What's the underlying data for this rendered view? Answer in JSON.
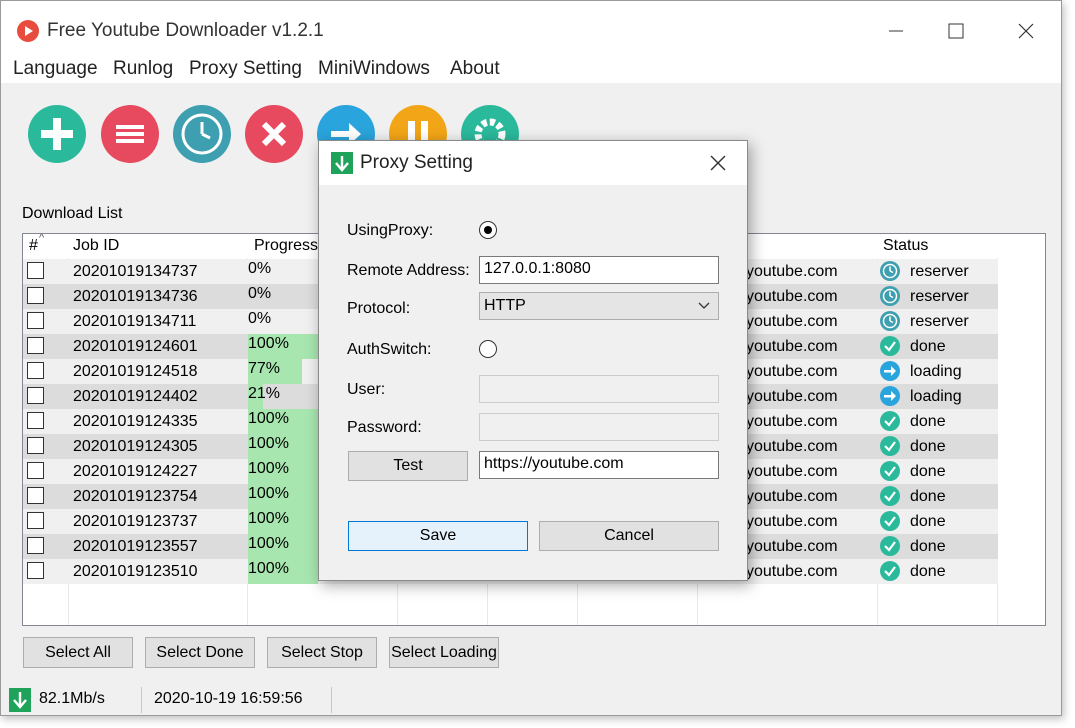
{
  "window": {
    "title": "Free Youtube Downloader v1.2.1"
  },
  "menu": [
    "Language",
    "Runlog",
    "Proxy Setting",
    "MiniWindows",
    "About"
  ],
  "toolbar": [
    {
      "name": "add-icon",
      "color": "#2bb99c"
    },
    {
      "name": "list-icon",
      "color": "#e74a5f"
    },
    {
      "name": "clock-icon",
      "color": "#3d9fb0"
    },
    {
      "name": "delete-icon",
      "color": "#e74a5f"
    },
    {
      "name": "start-icon",
      "color": "#2aa4dc"
    },
    {
      "name": "pause-icon",
      "color": "#f2a516"
    },
    {
      "name": "settings-icon",
      "color": "#2bb99c"
    }
  ],
  "list": {
    "label": "Download List",
    "columns": [
      "#",
      "Job ID",
      "ProgressR",
      "Status"
    ],
    "url_text": "youtube.com",
    "rows": [
      {
        "job_id": "20201019134737",
        "progress": "0%",
        "progress_value": 0,
        "status": "reserver",
        "status_icon": "clock-icon"
      },
      {
        "job_id": "20201019134736",
        "progress": "0%",
        "progress_value": 0,
        "status": "reserver",
        "status_icon": "clock-icon"
      },
      {
        "job_id": "20201019134711",
        "progress": "0%",
        "progress_value": 0,
        "status": "reserver",
        "status_icon": "clock-icon"
      },
      {
        "job_id": "20201019124601",
        "progress": "100%",
        "progress_value": 100,
        "status": "done",
        "status_icon": "check-icon"
      },
      {
        "job_id": "20201019124518",
        "progress": "77%",
        "progress_value": 77,
        "status": "loading",
        "status_icon": "arrow-icon"
      },
      {
        "job_id": "20201019124402",
        "progress": "21%",
        "progress_value": 21,
        "status": "loading",
        "status_icon": "arrow-icon"
      },
      {
        "job_id": "20201019124335",
        "progress": "100%",
        "progress_value": 100,
        "status": "done",
        "status_icon": "check-icon"
      },
      {
        "job_id": "20201019124305",
        "progress": "100%",
        "progress_value": 100,
        "status": "done",
        "status_icon": "check-icon"
      },
      {
        "job_id": "20201019124227",
        "progress": "100%",
        "progress_value": 100,
        "status": "done",
        "status_icon": "check-icon"
      },
      {
        "job_id": "20201019123754",
        "progress": "100%",
        "progress_value": 100,
        "status": "done",
        "status_icon": "check-icon"
      },
      {
        "job_id": "20201019123737",
        "progress": "100%",
        "progress_value": 100,
        "status": "done",
        "status_icon": "check-icon"
      },
      {
        "job_id": "20201019123557",
        "progress": "100%",
        "progress_value": 100,
        "status": "done",
        "status_icon": "check-icon"
      },
      {
        "job_id": "20201019123510",
        "progress": "100%",
        "progress_value": 100,
        "status": "done",
        "status_icon": "check-icon"
      }
    ]
  },
  "buttons": {
    "select_all": "Select All",
    "select_done": "Select Done",
    "select_stop": "Select Stop",
    "select_loading": "Select Loading"
  },
  "statusbar": {
    "speed": "82.1Mb/s",
    "datetime": "2020-10-19 16:59:56"
  },
  "dialog": {
    "title": "Proxy Setting",
    "using_proxy_label": "UsingProxy:",
    "using_proxy_checked": true,
    "remote_address_label": "Remote Address:",
    "remote_address_value": "127.0.0.1:8080",
    "protocol_label": "Protocol:",
    "protocol_value": "HTTP",
    "auth_switch_label": "AuthSwitch:",
    "auth_switch_checked": false,
    "user_label": "User:",
    "user_value": "",
    "password_label": "Password:",
    "password_value": "",
    "test_button": "Test",
    "test_url": "https://youtube.com",
    "save_button": "Save",
    "cancel_button": "Cancel"
  },
  "colors": {
    "done": "#2bb99c",
    "loading": "#2aa4dc",
    "reserver": "#3d9fb0",
    "progress_fill": "#a8e6b0"
  }
}
